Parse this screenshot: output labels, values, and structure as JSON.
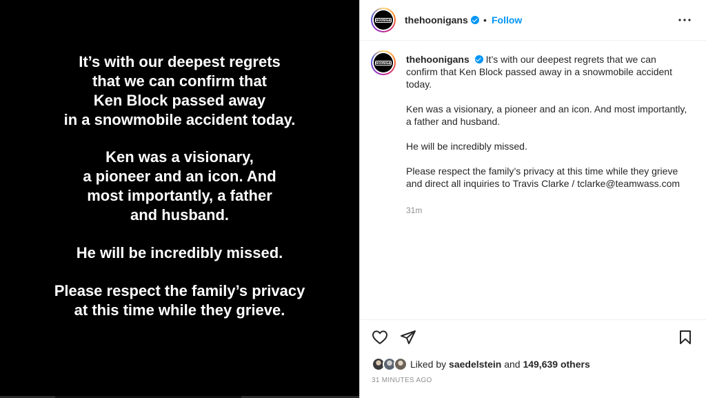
{
  "post_image": {
    "paragraphs": [
      "It’s with our deepest regrets\nthat we can confirm that\nKen Block passed away\nin a snowmobile accident today.",
      "Ken was a visionary,\na pioneer and an icon. And\nmost importantly, a father\nand husband.",
      "He will be incredibly missed.",
      "Please respect the family’s privacy\nat this time while they grieve."
    ]
  },
  "header": {
    "username": "thehoonigans",
    "verified": true,
    "separator": "•",
    "follow_label": "Follow",
    "avatar_logo_text": "HOONIGAN",
    "more_icon": "more-horizontal-icon"
  },
  "caption": {
    "username": "thehoonigans",
    "text_first": "It’s with our deepest regrets that we can confirm that Ken Block passed away in a snowmobile accident today.",
    "text_second": "Ken was a visionary, a pioneer and an icon. And most importantly, a father and husband.",
    "text_third": "He will be incredibly missed.",
    "text_fourth": "Please respect the family’s privacy at this time while they grieve and direct all inquiries to Travis Clarke / tclarke@teamwass.com",
    "time": "31m"
  },
  "actions": {
    "like_icon": "heart-icon",
    "share_icon": "paper-plane-icon",
    "save_icon": "bookmark-icon"
  },
  "likes": {
    "prefix": "Liked by",
    "first_liker": "saedelstein",
    "conjunction": "and",
    "others": "149,639 others"
  },
  "time_ago": "31 MINUTES AGO",
  "colors": {
    "accent": "#0095f6",
    "text": "#262626",
    "muted": "#8e8e8e",
    "image_bg": "#000000"
  }
}
